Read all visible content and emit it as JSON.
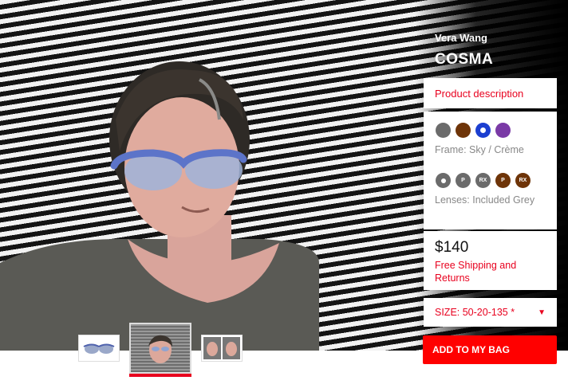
{
  "product": {
    "brand": "Vera Wang",
    "model": "COSMA",
    "description_label": "Product description",
    "frame_label": "Frame: Sky / Crème",
    "lenses_label": "Lenses: Included Grey",
    "price": "$140",
    "shipping": "Free Shipping and Returns",
    "size_label": "SIZE: 50-20-135 *",
    "size_caret": "▼",
    "add_to_bag": "ADD TO MY BAG"
  },
  "frame_colors": [
    "#6b6b6b",
    "#6e3408",
    "#1c3fd0",
    "#7a3aa6"
  ],
  "lens_options": [
    {
      "color": "#6b6b6b",
      "label": ""
    },
    {
      "color": "#6b6b6b",
      "label": "P"
    },
    {
      "color": "#6b6b6b",
      "label": "RX"
    },
    {
      "color": "#6e3408",
      "label": "P"
    },
    {
      "color": "#6e3408",
      "label": "RX"
    }
  ],
  "accent_color": "#e8001e"
}
